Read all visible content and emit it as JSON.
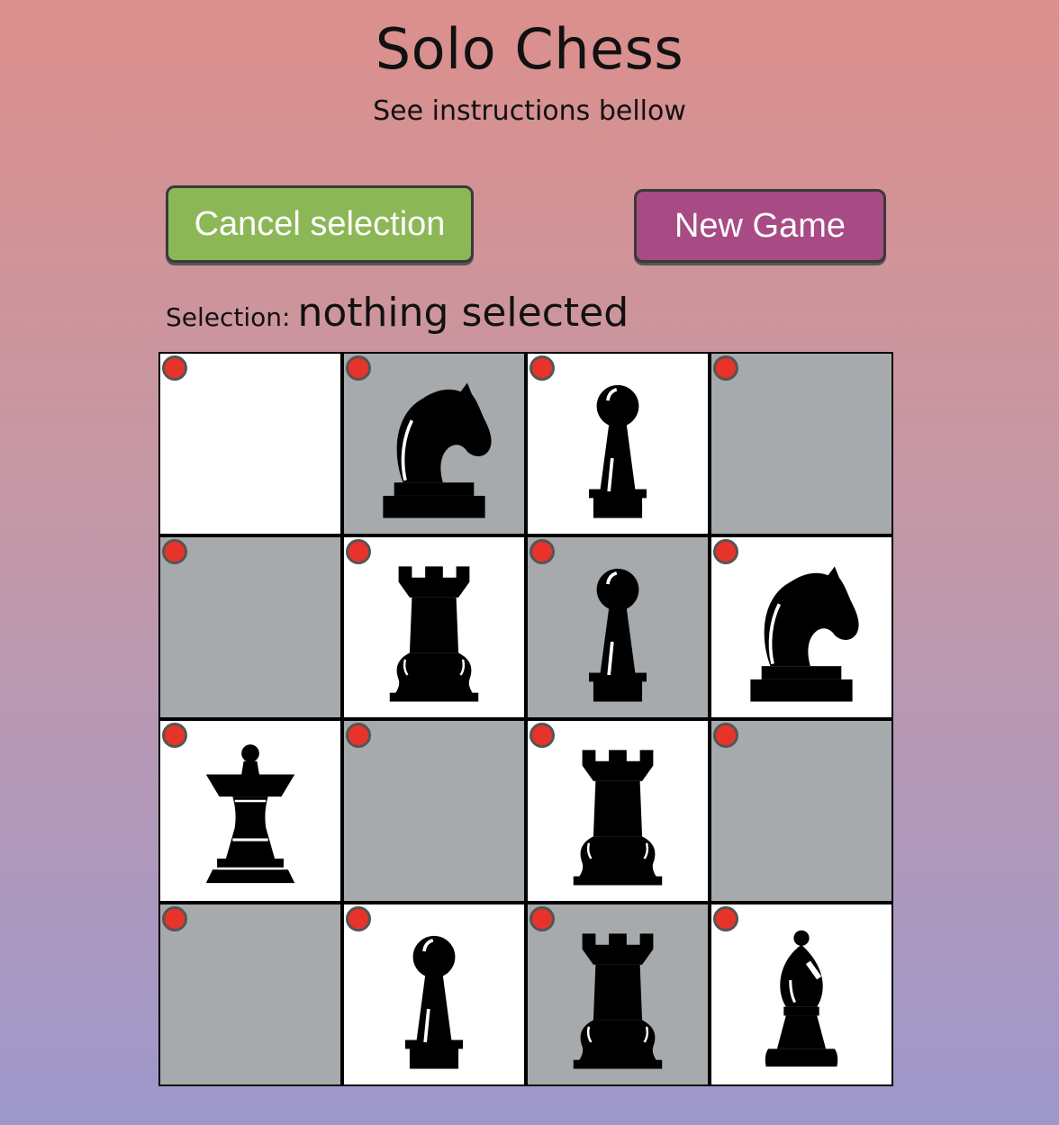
{
  "header": {
    "title": "Solo Chess",
    "subtitle": "See instructions bellow"
  },
  "controls": {
    "cancel_label": "Cancel selection",
    "new_game_label": "New Game"
  },
  "selection": {
    "label": "Selection:",
    "value": "nothing selected"
  },
  "colors": {
    "light_square": "#ffffff",
    "dark_square": "#a6aaad",
    "dot": "#e8332a",
    "cancel_button": "#8cb756",
    "new_game_button": "#a84a84"
  },
  "board": {
    "rows": [
      [
        {
          "shade": "light",
          "piece": null
        },
        {
          "shade": "dark",
          "piece": "knight"
        },
        {
          "shade": "light",
          "piece": "pawn"
        },
        {
          "shade": "dark",
          "piece": null
        }
      ],
      [
        {
          "shade": "dark",
          "piece": null
        },
        {
          "shade": "light",
          "piece": "rook"
        },
        {
          "shade": "dark",
          "piece": "pawn"
        },
        {
          "shade": "light",
          "piece": "knight"
        }
      ],
      [
        {
          "shade": "light",
          "piece": "queen"
        },
        {
          "shade": "dark",
          "piece": null
        },
        {
          "shade": "light",
          "piece": "rook"
        },
        {
          "shade": "dark",
          "piece": null
        }
      ],
      [
        {
          "shade": "dark",
          "piece": null
        },
        {
          "shade": "light",
          "piece": "pawn"
        },
        {
          "shade": "dark",
          "piece": "rook"
        },
        {
          "shade": "light",
          "piece": "bishop"
        }
      ]
    ]
  }
}
